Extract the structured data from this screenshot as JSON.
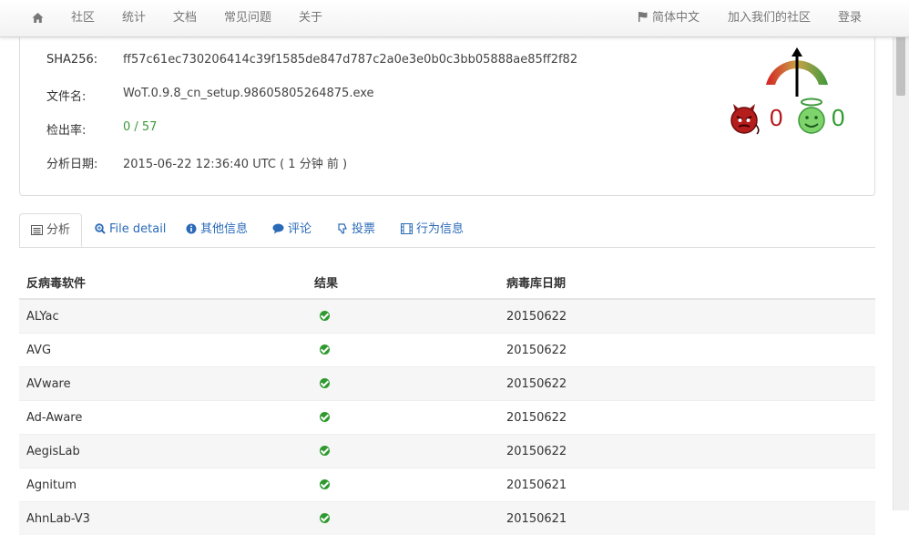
{
  "nav": {
    "home_icon": "home-icon",
    "items": [
      "社区",
      "统计",
      "文档",
      "常见问题",
      "关于"
    ],
    "language": "简体中文",
    "join": "加入我们的社区",
    "login": "登录"
  },
  "summary": {
    "sha256_label": "SHA256:",
    "sha256_value": "ff57c61ec730206414c39f1585de847d787c2a0e3e0b0c3bb05888ae85ff2f82",
    "filename_label": "文件名:",
    "filename_value": "WoT.0.9.8_cn_setup.98605805264875.exe",
    "ratio_label": "检出率:",
    "ratio_value": "0 / 57",
    "date_label": "分析日期:",
    "date_value": "2015-06-22 12:36:40 UTC ( 1 分钟 前 )"
  },
  "votes": {
    "malicious": "0",
    "harmless": "0",
    "colors": {
      "malicious": "#b4161b",
      "harmless": "#2f9a2f"
    }
  },
  "tabs": [
    {
      "label": "分析",
      "icon": "list-icon",
      "active": true
    },
    {
      "label": "File detail",
      "icon": "zoom-icon",
      "active": false
    },
    {
      "label": "其他信息",
      "icon": "info-icon",
      "active": false
    },
    {
      "label": "评论",
      "icon": "comment-icon",
      "active": false
    },
    {
      "label": "投票",
      "icon": "thumbs-down-icon",
      "active": false
    },
    {
      "label": "行为信息",
      "icon": "film-icon",
      "active": false
    }
  ],
  "table": {
    "headers": [
      "反病毒软件",
      "结果",
      "病毒库日期"
    ],
    "rows": [
      {
        "engine": "ALYac",
        "result": "clean",
        "date": "20150622"
      },
      {
        "engine": "AVG",
        "result": "clean",
        "date": "20150622"
      },
      {
        "engine": "AVware",
        "result": "clean",
        "date": "20150622"
      },
      {
        "engine": "Ad-Aware",
        "result": "clean",
        "date": "20150622"
      },
      {
        "engine": "AegisLab",
        "result": "clean",
        "date": "20150622"
      },
      {
        "engine": "Agnitum",
        "result": "clean",
        "date": "20150621"
      },
      {
        "engine": "AhnLab-V3",
        "result": "clean",
        "date": "20150621"
      }
    ]
  }
}
